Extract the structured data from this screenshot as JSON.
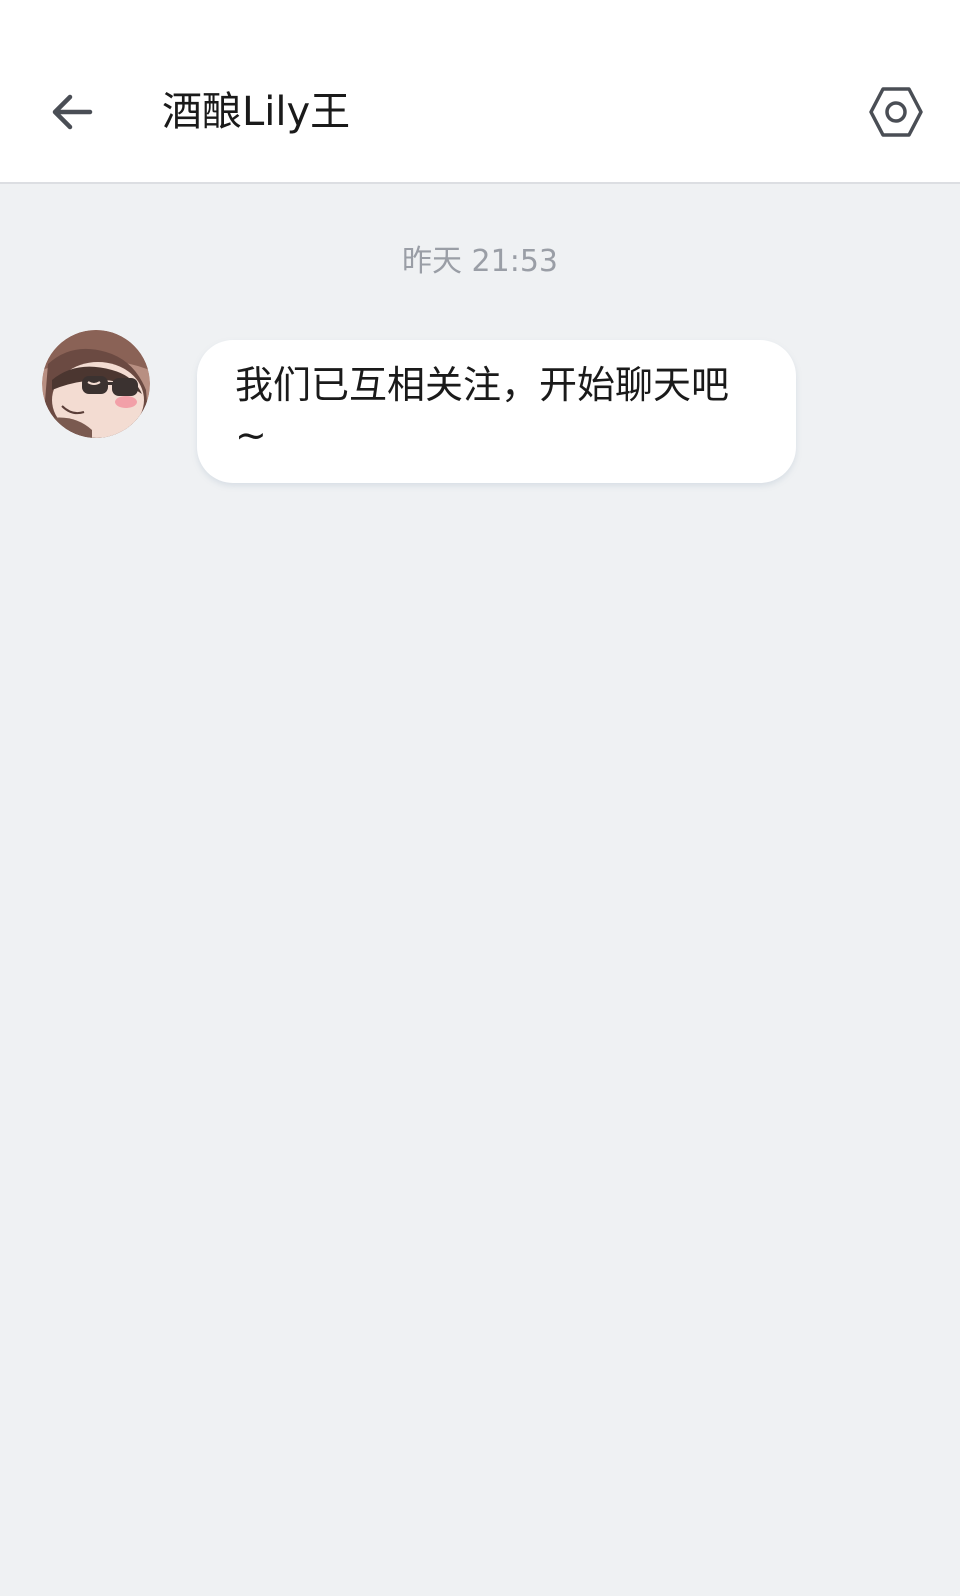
{
  "header": {
    "back_icon": "arrow-left-icon",
    "title": "酒酿Lily王",
    "settings_icon": "hexagon-settings-icon"
  },
  "chat": {
    "timestamp": "昨天 21:53",
    "messages": [
      {
        "sender": "other",
        "avatar_icon": "cartoon-avatar-sunglasses",
        "text": "我们已互相关注，开始聊天吧~"
      }
    ]
  },
  "colors": {
    "background": "#eff1f3",
    "header_bg": "#ffffff",
    "bubble_bg": "#ffffff",
    "icon": "#4a4e55",
    "timestamp": "#9a9ea6"
  }
}
